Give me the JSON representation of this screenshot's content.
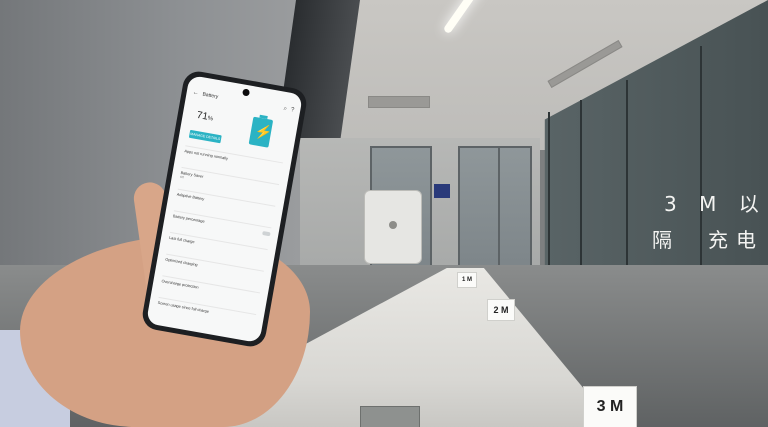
{
  "phone": {
    "app_title": "Battery",
    "battery_percent": "71",
    "percent_sign": "%",
    "more_button": "MANAGE DETAILS",
    "battery_fill_fraction": 0.71,
    "accent_color": "#2bb3c4",
    "top_icons": [
      "back-arrow-icon",
      "search-icon",
      "help-icon"
    ],
    "settings_rows": [
      {
        "title": "Apps not running normally",
        "sub": "",
        "toggle": false
      },
      {
        "title": "Battery Saver",
        "sub": "Off",
        "toggle": false
      },
      {
        "title": "Adaptive Battery",
        "sub": "",
        "toggle": false
      },
      {
        "title": "Battery percentage",
        "sub": "",
        "toggle": true
      },
      {
        "title": "Last full charge",
        "sub": "",
        "toggle": false
      },
      {
        "title": "Optimized charging",
        "sub": "",
        "toggle": false
      },
      {
        "title": "Overcharge protection",
        "sub": "",
        "toggle": false
      },
      {
        "title": "Screen usage since full charge",
        "sub": "",
        "toggle": false
      }
    ]
  },
  "signs": {
    "near": "3 M",
    "mid": "2 M",
    "far": "1 M"
  },
  "caption": {
    "line1": "3 M 以",
    "line2": "隔　充电"
  }
}
